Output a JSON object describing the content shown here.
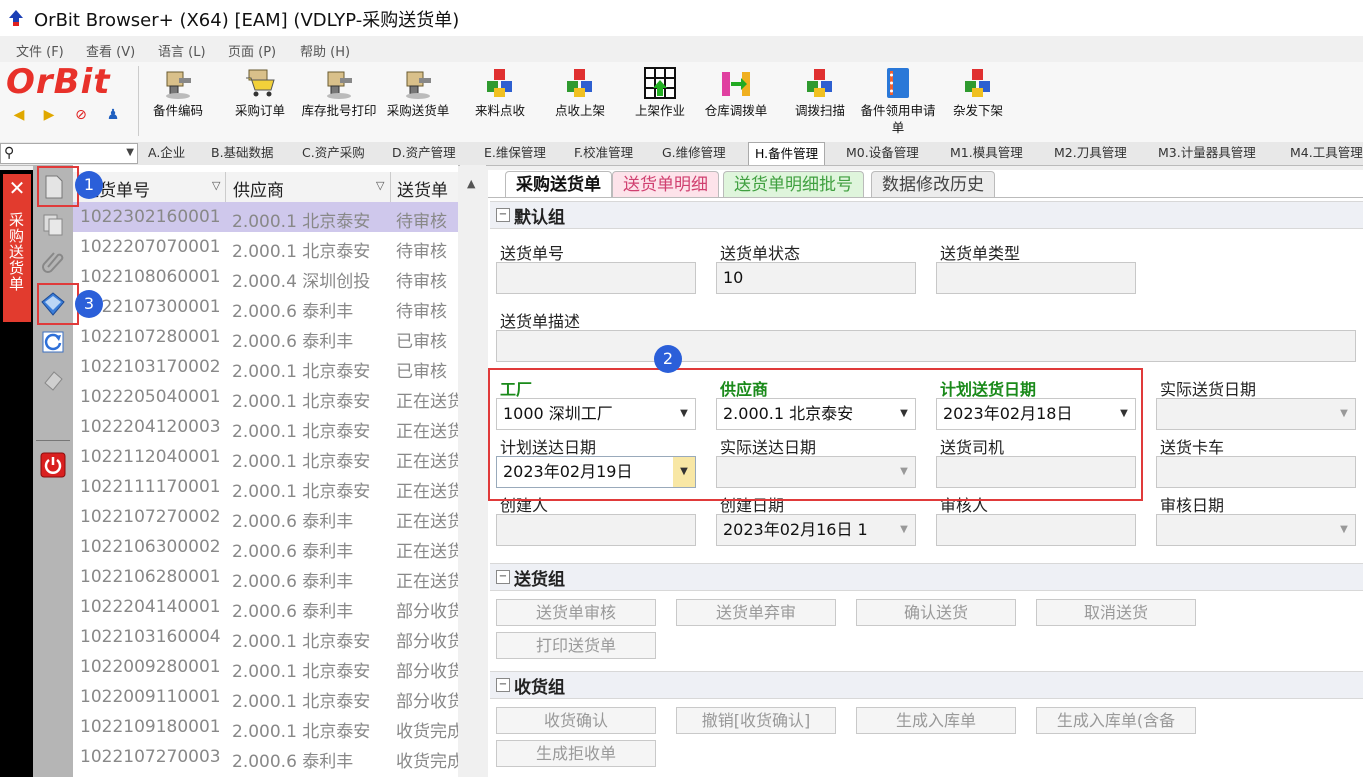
{
  "window": {
    "title": "OrBit Browser+ (X64) [EAM] (VDLYP-采购送货单)"
  },
  "menu": [
    "文件 (F)",
    "查看 (V)",
    "语言 (L)",
    "页面 (P)",
    "帮助 (H)"
  ],
  "logo": "OrBit",
  "toolbar": [
    {
      "label": "备件编码",
      "icon": "drill-icon"
    },
    {
      "label": "采购订单",
      "icon": "cart-icon"
    },
    {
      "label": "库存批号打印",
      "icon": "drill-icon"
    },
    {
      "label": "采购送货单",
      "icon": "drill-icon"
    },
    {
      "label": "来料点收",
      "icon": "cubes-icon"
    },
    {
      "label": "点收上架",
      "icon": "cubes-icon"
    },
    {
      "label": "上架作业",
      "icon": "grid-arrow-icon"
    },
    {
      "label": "仓库调拨单",
      "icon": "transfer-icon"
    },
    {
      "label": "调拨扫描",
      "icon": "cubes-icon"
    },
    {
      "label": "备件领用申请单",
      "icon": "binder-icon"
    },
    {
      "label": "杂发下架",
      "icon": "cubes-icon"
    }
  ],
  "module_tabs": [
    "A.企业",
    "B.基础数据",
    "C.资产采购",
    "D.资产管理",
    "E.维保管理",
    "F.校准管理",
    "G.维修管理",
    "H.备件管理",
    "M0.设备管理",
    "M1.模具管理",
    "M2.刀具管理",
    "M3.计量器具管理",
    "M4.工具管理"
  ],
  "active_module": "H.备件管理",
  "side_tab": {
    "label": "采购送货单"
  },
  "grid": {
    "headers": [
      "送货单号",
      "供应商",
      "送货单"
    ],
    "rows": [
      [
        "1022302160001",
        "2.000.1 北京泰安",
        "待审核"
      ],
      [
        "1022207070001",
        "2.000.1 北京泰安",
        "待审核"
      ],
      [
        "1022108060001",
        "2.000.4 深圳创投",
        "待审核"
      ],
      [
        "1022107300001",
        "2.000.6 泰利丰",
        "待审核"
      ],
      [
        "1022107280001",
        "2.000.6 泰利丰",
        "已审核"
      ],
      [
        "1022103170002",
        "2.000.1 北京泰安",
        "已审核"
      ],
      [
        "1022205040001",
        "2.000.1 北京泰安",
        "正在送货"
      ],
      [
        "1022204120003",
        "2.000.1 北京泰安",
        "正在送货"
      ],
      [
        "1022112040001",
        "2.000.1 北京泰安",
        "正在送货"
      ],
      [
        "1022111170001",
        "2.000.1 北京泰安",
        "正在送货"
      ],
      [
        "1022107270002",
        "2.000.6 泰利丰",
        "正在送货"
      ],
      [
        "1022106300002",
        "2.000.6 泰利丰",
        "正在送货"
      ],
      [
        "1022106280001",
        "2.000.6 泰利丰",
        "正在送货"
      ],
      [
        "1022204140001",
        "2.000.6 泰利丰",
        "部分收货"
      ],
      [
        "1022103160004",
        "2.000.1 北京泰安",
        "部分收货"
      ],
      [
        "1022009280001",
        "2.000.1 北京泰安",
        "部分收货"
      ],
      [
        "1022009110001",
        "2.000.1 北京泰安",
        "部分收货"
      ],
      [
        "1022109180001",
        "2.000.1 北京泰安",
        "收货完成"
      ],
      [
        "1022107270003",
        "2.000.6 泰利丰",
        "收货完成"
      ]
    ]
  },
  "form_tabs": [
    "采购送货单",
    "送货单明细",
    "送货单明细批号",
    "数据修改历史"
  ],
  "groups": {
    "default": "默认组",
    "delivery": "送货组",
    "receiving": "收货组"
  },
  "fields": {
    "delivery_no": {
      "label": "送货单号",
      "value": ""
    },
    "delivery_status": {
      "label": "送货单状态",
      "value": "10"
    },
    "delivery_type": {
      "label": "送货单类型",
      "value": ""
    },
    "delivery_desc": {
      "label": "送货单描述",
      "value": ""
    },
    "factory": {
      "label": "工厂",
      "value": "1000 深圳工厂"
    },
    "supplier": {
      "label": "供应商",
      "value": "2.000.1 北京泰安"
    },
    "plan_delivery_date": {
      "label": "计划送货日期",
      "value": "2023年02月18日"
    },
    "actual_delivery_date": {
      "label": "实际送货日期",
      "value": ""
    },
    "plan_arrival_date": {
      "label": "计划送达日期",
      "value": "2023年02月19日"
    },
    "actual_arrival_date": {
      "label": "实际送达日期",
      "value": ""
    },
    "driver": {
      "label": "送货司机",
      "value": ""
    },
    "truck": {
      "label": "送货卡车",
      "value": ""
    },
    "creator": {
      "label": "创建人",
      "value": ""
    },
    "create_date": {
      "label": "创建日期",
      "value": "2023年02月16日 1"
    },
    "reviewer": {
      "label": "审核人",
      "value": ""
    },
    "review_date": {
      "label": "审核日期",
      "value": ""
    }
  },
  "delivery_buttons": [
    "送货单审核",
    "送货单弃审",
    "确认送货",
    "取消送货",
    "打印送货单"
  ],
  "receiving_buttons": [
    "收货确认",
    "撤销[收货确认]",
    "生成入库单",
    "生成入库单(含备",
    "生成拒收单"
  ],
  "annotations": [
    "1",
    "2",
    "3"
  ],
  "colors": {
    "brand": "#e8312a",
    "required_label": "#1a8a1a",
    "selected_row": "#cfc8ec",
    "annotation": "#e03a3a",
    "badge": "#2b5fd9"
  }
}
